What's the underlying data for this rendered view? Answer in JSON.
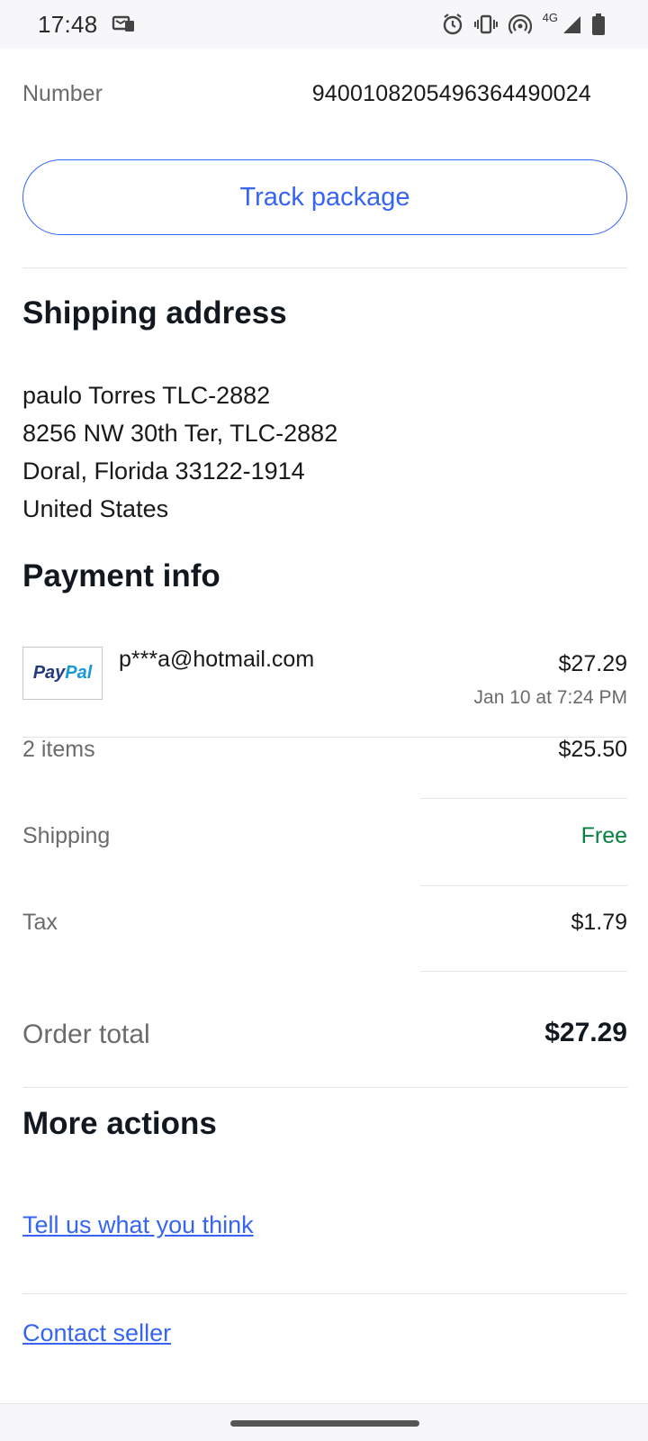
{
  "status_bar": {
    "time": "17:48",
    "network": "4G",
    "icons": [
      "notification-icon",
      "alarm-icon",
      "vibrate-icon",
      "hotspot-icon",
      "signal-icon",
      "battery-icon"
    ]
  },
  "tracking": {
    "label": "Number",
    "number": "9400108205496364490024",
    "button_label": "Track package"
  },
  "shipping": {
    "title": "Shipping address",
    "lines": [
      "paulo Torres TLC-2882",
      "8256 NW 30th Ter, TLC-2882",
      "Doral, Florida 33122-1914",
      "United States"
    ]
  },
  "payment": {
    "title": "Payment info",
    "method_logo_left": "Pay",
    "method_logo_right": "Pal",
    "account": "p***a@hotmail.com",
    "amount": "$27.29",
    "date": "Jan 10 at 7:24 PM"
  },
  "summary": {
    "rows": [
      {
        "label": "2 items",
        "value": "$25.50"
      },
      {
        "label": "Shipping",
        "value": "Free"
      },
      {
        "label": "Tax",
        "value": "$1.79"
      }
    ],
    "total_label": "Order total",
    "total_value": "$27.29"
  },
  "actions": {
    "title": "More actions",
    "links": [
      "Tell us what you think",
      "Contact seller"
    ]
  },
  "colors": {
    "accent": "#3665f3",
    "free": "#05823f",
    "muted": "#6b6b6b",
    "divider": "#e5e5e5"
  }
}
